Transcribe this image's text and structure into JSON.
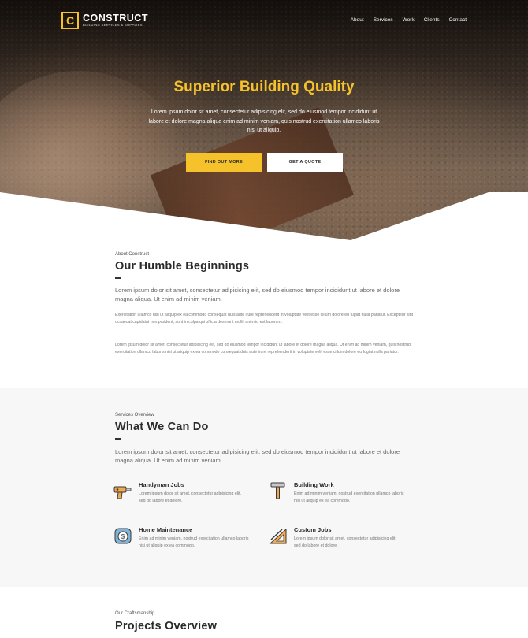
{
  "brand": {
    "logo_letter": "C",
    "name": "CONSTRUCT",
    "tagline": "BUILDING SERVICES & SUPPLIES",
    "accent_color": "#f5c22b"
  },
  "nav": {
    "items": [
      "About",
      "Services",
      "Work",
      "Clients",
      "Contact"
    ]
  },
  "hero": {
    "title": "Superior Building Quality",
    "subtitle": "Lorem ipsum dolor sit amet, consectetur adipisicing elit, sed do eiusmod tempor incididunt ut labore et dolore magna aliqua enim ad minim veniam, quis nostrud exercitation ullamco laboris nisi ut aliquip.",
    "primary_button": "FIND OUT MORE",
    "secondary_button": "GET A QUOTE"
  },
  "about": {
    "kicker": "About Construct",
    "title": "Our Humble Beginnings",
    "lead": "Lorem ipsum dolor sit amet, consectetur adipisicing elit, sed do eiusmod tempor incididunt ut labore et dolore magna aliqua. Ut enim ad minim veniam.",
    "paragraph_1": "Exercitation ullamco nisi ut aliquip ex ea commodo consequat duis aute irure reprehenderit in voluptate velit esse cillum dolore eu fugiat nulla pariatur. Excepteur sint occaecat cupidatat non proident, sunt in culpa qui officia deserunt mollit anim id est laborum.",
    "paragraph_2": "Lorem ipsum dolor sit amet, consectetur adipisicing elit, sed do eiusmod tempor incididunt ut labore et dolore magna aliqua. Ut enim ad minim veniam, quis nostrud exercitation ullamco laboris nisi ut aliquip ex ea commodo consequat duis aute irure reprehenderit in voluptate velit esse cillum dolore eu fugiat nulla pariatur."
  },
  "services": {
    "kicker": "Services Overview",
    "title": "What We Can Do",
    "lead": "Lorem ipsum dolor sit amet, consectetur adipisicing elit, sed do eiusmod tempor incididunt ut labore et dolore magna aliqua. Ut enim ad minim veniam.",
    "items": [
      {
        "icon": "drill-icon",
        "title": "Handyman Jobs",
        "text": "Lorem ipsum dolor sit amet, consectetur adipisicing elit, sed do labore et dolore."
      },
      {
        "icon": "hammer-icon",
        "title": "Building Work",
        "text": "Enim ad minim veniam, nostrud exercitation ullamco laboris nisi ut aliquip ex ea commodo."
      },
      {
        "icon": "meter-icon",
        "title": "Home Maintenance",
        "text": "Enim ad minim veniam, nostrud exercitation ullamco laboris nisi ut aliquip ex ea commodo."
      },
      {
        "icon": "ruler-triangle-icon",
        "title": "Custom Jobs",
        "text": "Lorem ipsum dolor sit amet, consectetur adipisicing elit, sed do labore et dolore."
      }
    ]
  },
  "projects": {
    "kicker": "Our Craftsmanship",
    "title": "Projects Overview"
  }
}
